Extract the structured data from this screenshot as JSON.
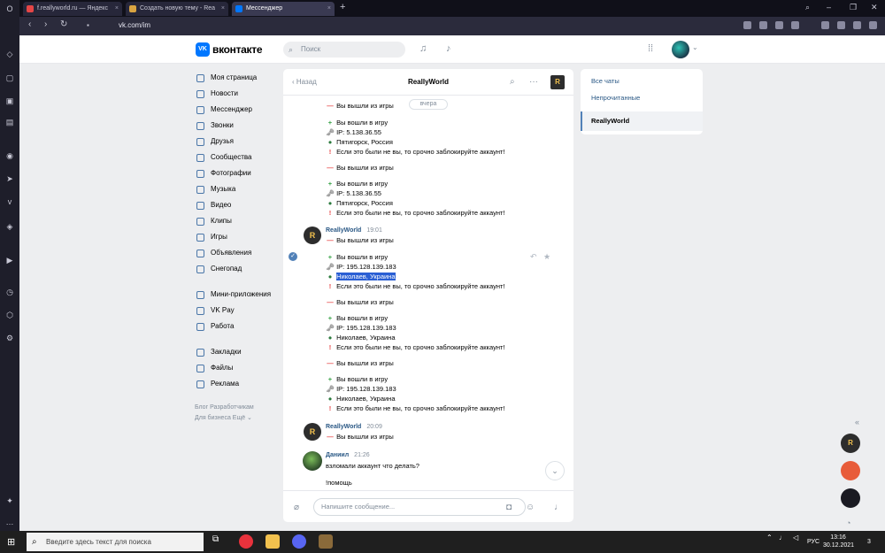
{
  "browser": {
    "tabs": [
      {
        "title": "f.reallyworld.ru — Яндекс",
        "color": "#e64646"
      },
      {
        "title": "Создать новую тему - Rea",
        "color": "#d9a441"
      },
      {
        "title": "Мессенджер",
        "color": "#0077ff"
      }
    ],
    "url": "vk.com/im"
  },
  "header": {
    "logo_text": "вконтакте",
    "logo_mark": "VK",
    "search_placeholder": "Поиск"
  },
  "sidebar": {
    "items": [
      "Моя страница",
      "Новости",
      "Мессенджер",
      "Звонки",
      "Друзья",
      "Сообщества",
      "Фотографии",
      "Музыка",
      "Видео",
      "Клипы",
      "Игры",
      "Объявления",
      "Снегопад"
    ],
    "items2": [
      "Мини-приложения",
      "VK Pay",
      "Работа"
    ],
    "items3": [
      "Закладки",
      "Файлы",
      "Реклама"
    ],
    "footer1": "Блог  Разработчикам",
    "footer2": "Для бизнеса   Ещё ⌄"
  },
  "chat": {
    "back": "Назад",
    "title": "ReallyWorld",
    "day_badge": "вчера",
    "logo_letter": "R",
    "messages": [
      {
        "t": "minus",
        "text": "Вы вышли из игры"
      },
      {
        "t": "plus",
        "text": "Вы вошли в игру"
      },
      {
        "t": "key",
        "text": "IP: 5.138.36.55"
      },
      {
        "t": "globe",
        "text": "Пятигорск, Россия"
      },
      {
        "t": "excl",
        "text": "Если это были не вы, то срочно заблокируйте аккаунт!"
      },
      {
        "t": "minus",
        "text": "Вы вышли из игры"
      },
      {
        "t": "plus",
        "text": "Вы вошли в игру"
      },
      {
        "t": "key",
        "text": "IP: 5.138.36.55"
      },
      {
        "t": "globe",
        "text": "Пятигорск, Россия"
      },
      {
        "t": "excl",
        "text": "Если это были не вы, то срочно заблокируйте аккаунт!"
      },
      {
        "t": "minus",
        "text": "Вы вышли из игры"
      },
      {
        "t": "plus",
        "text": "Вы вошли в игру"
      },
      {
        "t": "key",
        "text": "IP: 195.128.139.183"
      },
      {
        "t": "globe",
        "text": "Николаев, Украина"
      },
      {
        "t": "excl",
        "text": "Если это были не вы, то срочно заблокируйте аккаунт!"
      },
      {
        "t": "minus",
        "text": "Вы вышли из игры"
      },
      {
        "t": "plus",
        "text": "Вы вошли в игру"
      },
      {
        "t": "key",
        "text": "IP: 195.128.139.183"
      },
      {
        "t": "globe",
        "text": "Николаев, Украина"
      },
      {
        "t": "excl",
        "text": "Если это были не вы, то срочно заблокируйте аккаунт!"
      },
      {
        "t": "minus",
        "text": "Вы вышли из игры"
      },
      {
        "t": "plus",
        "text": "Вы вошли в игру"
      },
      {
        "t": "key",
        "text": "IP: 195.128.139.183"
      },
      {
        "t": "globe",
        "text": "Николаев, Украина"
      },
      {
        "t": "excl",
        "text": "Если это были не вы, то срочно заблокируйте аккаунт!"
      },
      {
        "t": "minus",
        "text": "Вы вышли из игры"
      },
      {
        "t": "none",
        "text": "взломали аккаунт что делать?"
      },
      {
        "t": "none",
        "text": "!помощь"
      }
    ],
    "authors": [
      {
        "name": "ReallyWorld",
        "time": "19:01"
      },
      {
        "name": "ReallyWorld",
        "time": "20:09"
      },
      {
        "name": "Даниил",
        "time": "21:26"
      }
    ],
    "compose_placeholder": "Напишите сообщение..."
  },
  "right_panel": {
    "all": "Все чаты",
    "unread": "Непрочитанные",
    "active": "ReallyWorld"
  },
  "taskbar": {
    "search": "Введите здесь текст для поиска",
    "lang": "РУС",
    "time": "13:16",
    "date": "30.12.2021",
    "notif": "3"
  },
  "icons": {
    "plus": "+",
    "minus": "—",
    "key": "🗝",
    "globe": "●",
    "excl": "!"
  }
}
